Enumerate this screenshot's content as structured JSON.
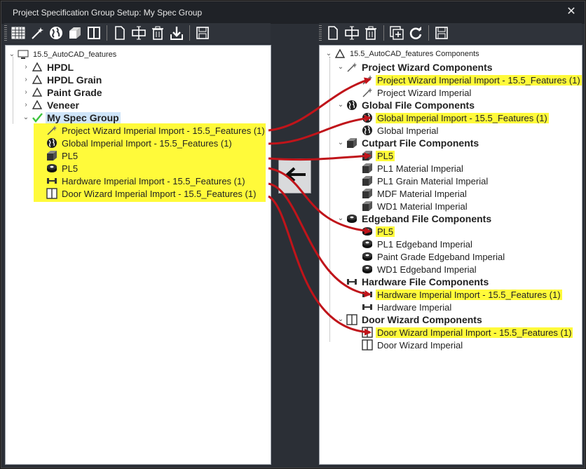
{
  "window": {
    "title": "Project Specification Group Setup: My Spec Group",
    "close_glyph": "✕"
  },
  "toolbar_left": [
    "table-icon",
    "magic-wand-icon",
    "globe-icon",
    "cutpart-icon",
    "door-icon",
    "copy-icon",
    "insert-icon",
    "trash-icon",
    "import-icon",
    "save-icon"
  ],
  "toolbar_right": [
    "copy-icon",
    "insert-icon",
    "trash-icon",
    "add-group-icon",
    "refresh-icon",
    "save-icon"
  ],
  "left_tree": {
    "root": "15.5_AutoCAD_features",
    "groups": [
      "HPDL",
      "HPDL Grain",
      "Paint Grade",
      "Veneer"
    ],
    "selected_group": "My Spec Group",
    "children": [
      "Project Wizard Imperial Import - 15.5_Features (1)",
      "Global Imperial Import - 15.5_Features (1)",
      "PL5",
      "PL5",
      "Hardware Imperial Import - 15.5_Features (1)",
      "Door Wizard Imperial Import - 15.5_Features (1)"
    ]
  },
  "right_tree": {
    "root": "15.5_AutoCAD_features Components",
    "sections": [
      {
        "title": "Project Wizard Components",
        "items": [
          "Project Wizard Imperial Import - 15.5_Features (1)",
          "Project Wizard Imperial"
        ]
      },
      {
        "title": "Global File Components",
        "items": [
          "Global Imperial Import - 15.5_Features (1)",
          "Global Imperial"
        ]
      },
      {
        "title": "Cutpart File Components",
        "items": [
          "PL5",
          "PL1 Material Imperial",
          "PL1 Grain Material Imperial",
          "MDF Material Imperial",
          "WD1 Material Imperial"
        ]
      },
      {
        "title": "Edgeband File Components",
        "items": [
          "PL5",
          "PL1 Edgeband Imperial",
          "Paint Grade Edgeband Imperial",
          "WD1 Edgeband Imperial"
        ]
      },
      {
        "title": "Hardware File Components",
        "items": [
          "Hardware Imperial Import - 15.5_Features (1)",
          "Hardware Imperial"
        ]
      },
      {
        "title": "Door Wizard Components",
        "items": [
          "Door Wizard Imperial Import - 15.5_Features (1)",
          "Door Wizard Imperial"
        ]
      }
    ]
  },
  "colors": {
    "highlight": "#fffa3a",
    "arrow": "#c0141a",
    "check": "#3cc43c",
    "selected": "#cfe5f9"
  }
}
